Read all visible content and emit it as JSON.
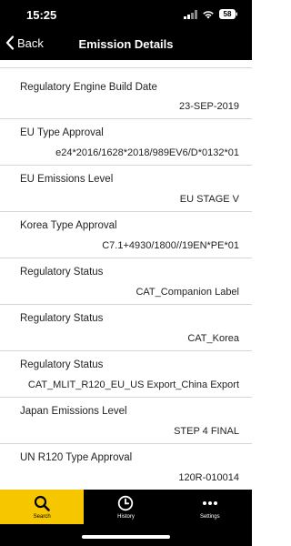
{
  "status_bar": {
    "time": "15:25",
    "battery": "58"
  },
  "nav": {
    "back_label": "Back",
    "title": "Emission Details"
  },
  "rows": [
    {
      "label": "Regulatory Engine Build Date",
      "value": "23-SEP-2019"
    },
    {
      "label": "EU Type Approval",
      "value": "e24*2016/1628*2018/989EV6/D*0132*01"
    },
    {
      "label": "EU Emissions Level",
      "value": "EU STAGE V"
    },
    {
      "label": "Korea Type Approval",
      "value": "C7.1+4930/1800//19EN*PE*01"
    },
    {
      "label": "Regulatory Status",
      "value": "CAT_Companion Label"
    },
    {
      "label": "Regulatory Status",
      "value": "CAT_Korea"
    },
    {
      "label": "Regulatory Status",
      "value": "CAT_MLIT_R120_EU_US Export_China Export"
    },
    {
      "label": "Japan Emissions Level",
      "value": "STEP 4 FINAL"
    },
    {
      "label": "UN R120 Type Approval",
      "value": "120R-010014"
    }
  ],
  "tabs": [
    {
      "label": "Search",
      "icon": "search-icon",
      "active": true
    },
    {
      "label": "History",
      "icon": "clock-icon",
      "active": false
    },
    {
      "label": "Settings",
      "icon": "more-dots-icon",
      "active": false
    }
  ],
  "colors": {
    "accent": "#f6c700",
    "header_bg": "#000000",
    "divider": "#d6d6d6"
  }
}
